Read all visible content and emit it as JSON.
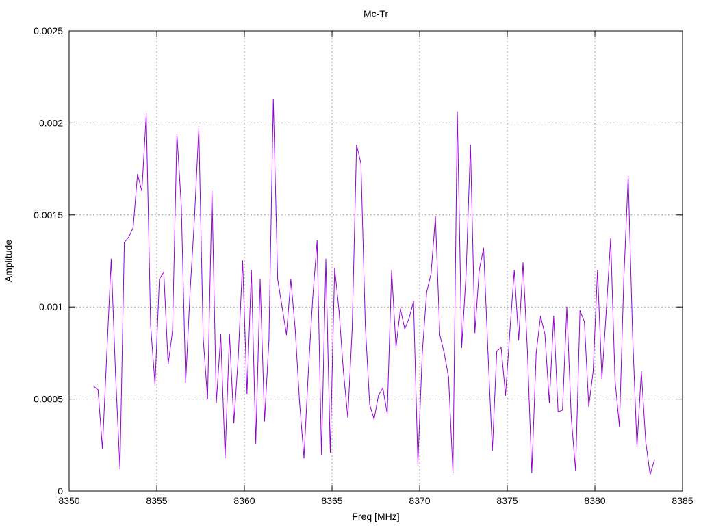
{
  "chart_data": {
    "type": "line",
    "title": "Mc-Tr",
    "xlabel": "Freq [MHz]",
    "ylabel": "Amplitude",
    "xlim": [
      8350,
      8385
    ],
    "ylim": [
      0,
      0.0025
    ],
    "xticks": [
      8350,
      8355,
      8360,
      8365,
      8370,
      8375,
      8380,
      8385
    ],
    "xtick_labels": [
      "8350",
      "8355",
      "8360",
      "8365",
      "8370",
      "8375",
      "8380",
      "8385"
    ],
    "yticks": [
      0,
      0.0005,
      0.001,
      0.0015,
      0.002,
      0.0025
    ],
    "ytick_labels": [
      "0",
      "0.0005",
      "0.001",
      "0.0015",
      "0.002",
      "0.0025"
    ],
    "grid": true,
    "series": [
      {
        "color": "#9400d3",
        "points": [
          [
            8351.4,
            0.00057
          ],
          [
            8351.65,
            0.00055
          ],
          [
            8351.9,
            0.00023
          ],
          [
            8352.15,
            0.00075
          ],
          [
            8352.4,
            0.00126
          ],
          [
            8352.65,
            0.00063
          ],
          [
            8352.9,
            0.00012
          ],
          [
            8353.15,
            0.00135
          ],
          [
            8353.4,
            0.00138
          ],
          [
            8353.65,
            0.00143
          ],
          [
            8353.9,
            0.00172
          ],
          [
            8354.15,
            0.00163
          ],
          [
            8354.4,
            0.00205
          ],
          [
            8354.65,
            0.0009
          ],
          [
            8354.9,
            0.00058
          ],
          [
            8355.15,
            0.00115
          ],
          [
            8355.4,
            0.00119
          ],
          [
            8355.65,
            0.00069
          ],
          [
            8355.9,
            0.00087
          ],
          [
            8356.15,
            0.00194
          ],
          [
            8356.4,
            0.00155
          ],
          [
            8356.65,
            0.00059
          ],
          [
            8356.9,
            0.00108
          ],
          [
            8357.15,
            0.00148
          ],
          [
            8357.4,
            0.00197
          ],
          [
            8357.65,
            0.00083
          ],
          [
            8357.9,
            0.0005
          ],
          [
            8358.15,
            0.00163
          ],
          [
            8358.4,
            0.00048
          ],
          [
            8358.65,
            0.00085
          ],
          [
            8358.9,
            0.00018
          ],
          [
            8359.15,
            0.00085
          ],
          [
            8359.4,
            0.00037
          ],
          [
            8359.65,
            0.00073
          ],
          [
            8359.9,
            0.00125
          ],
          [
            8360.15,
            0.00053
          ],
          [
            8360.4,
            0.0012
          ],
          [
            8360.65,
            0.00026
          ],
          [
            8360.9,
            0.00115
          ],
          [
            8361.15,
            0.00038
          ],
          [
            8361.4,
            0.00082
          ],
          [
            8361.65,
            0.00213
          ],
          [
            8361.9,
            0.00115
          ],
          [
            8362.15,
            0.001
          ],
          [
            8362.4,
            0.00085
          ],
          [
            8362.65,
            0.00115
          ],
          [
            8362.9,
            0.00088
          ],
          [
            8363.15,
            0.00048
          ],
          [
            8363.4,
            0.00018
          ],
          [
            8363.65,
            0.00065
          ],
          [
            8363.9,
            0.00105
          ],
          [
            8364.15,
            0.00136
          ],
          [
            8364.4,
            0.0002
          ],
          [
            8364.65,
            0.00126
          ],
          [
            8364.9,
            0.00021
          ],
          [
            8365.15,
            0.00121
          ],
          [
            8365.4,
            0.00098
          ],
          [
            8365.65,
            0.00065
          ],
          [
            8365.9,
            0.0004
          ],
          [
            8366.15,
            0.00088
          ],
          [
            8366.4,
            0.00188
          ],
          [
            8366.65,
            0.00178
          ],
          [
            8366.9,
            0.0009
          ],
          [
            8367.15,
            0.00047
          ],
          [
            8367.4,
            0.00039
          ],
          [
            8367.65,
            0.00052
          ],
          [
            8367.9,
            0.00056
          ],
          [
            8368.15,
            0.00042
          ],
          [
            8368.4,
            0.0012
          ],
          [
            8368.65,
            0.00078
          ],
          [
            8368.9,
            0.00099
          ],
          [
            8369.15,
            0.00088
          ],
          [
            8369.4,
            0.00094
          ],
          [
            8369.65,
            0.00103
          ],
          [
            8369.9,
            0.00015
          ],
          [
            8370.15,
            0.00075
          ],
          [
            8370.4,
            0.00108
          ],
          [
            8370.65,
            0.00118
          ],
          [
            8370.9,
            0.00149
          ],
          [
            8371.15,
            0.00085
          ],
          [
            8371.4,
            0.00075
          ],
          [
            8371.65,
            0.00062
          ],
          [
            8371.9,
            0.0001
          ],
          [
            8372.15,
            0.00206
          ],
          [
            8372.4,
            0.00078
          ],
          [
            8372.65,
            0.00118
          ],
          [
            8372.9,
            0.00188
          ],
          [
            8373.15,
            0.00086
          ],
          [
            8373.4,
            0.0012
          ],
          [
            8373.65,
            0.00132
          ],
          [
            8373.9,
            0.00075
          ],
          [
            8374.15,
            0.00022
          ],
          [
            8374.4,
            0.00076
          ],
          [
            8374.65,
            0.00078
          ],
          [
            8374.9,
            0.00052
          ],
          [
            8375.15,
            0.00087
          ],
          [
            8375.4,
            0.0012
          ],
          [
            8375.65,
            0.00082
          ],
          [
            8375.9,
            0.00124
          ],
          [
            8376.15,
            0.00076
          ],
          [
            8376.4,
            0.0001
          ],
          [
            8376.65,
            0.00075
          ],
          [
            8376.9,
            0.00095
          ],
          [
            8377.15,
            0.00085
          ],
          [
            8377.4,
            0.00048
          ],
          [
            8377.65,
            0.00095
          ],
          [
            8377.9,
            0.00043
          ],
          [
            8378.15,
            0.00044
          ],
          [
            8378.4,
            0.001
          ],
          [
            8378.65,
            0.0004
          ],
          [
            8378.9,
            0.00011
          ],
          [
            8379.15,
            0.00098
          ],
          [
            8379.4,
            0.00092
          ],
          [
            8379.65,
            0.00046
          ],
          [
            8379.9,
            0.00065
          ],
          [
            8380.15,
            0.0012
          ],
          [
            8380.4,
            0.00061
          ],
          [
            8380.65,
            0.00098
          ],
          [
            8380.9,
            0.00137
          ],
          [
            8381.15,
            0.0006
          ],
          [
            8381.4,
            0.00035
          ],
          [
            8381.65,
            0.00115
          ],
          [
            8381.9,
            0.00171
          ],
          [
            8382.15,
            0.00085
          ],
          [
            8382.4,
            0.00024
          ],
          [
            8382.65,
            0.00065
          ],
          [
            8382.9,
            0.00027
          ],
          [
            8383.15,
            9e-05
          ],
          [
            8383.4,
            0.00017
          ]
        ]
      }
    ]
  }
}
